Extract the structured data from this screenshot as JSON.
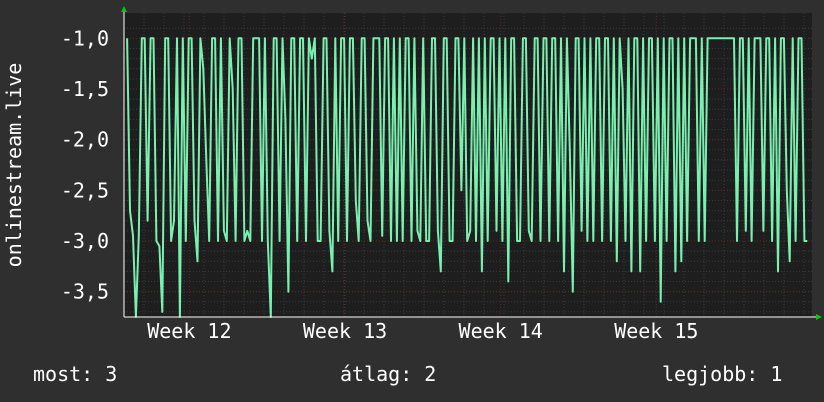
{
  "chart_data": {
    "type": "line",
    "ylabel": "onlinestream.live",
    "y_ticks": [
      "-1,0",
      "-1,5",
      "-2,0",
      "-2,5",
      "-3,0",
      "-3,5"
    ],
    "y_tick_values": [
      -1.0,
      -1.5,
      -2.0,
      -2.5,
      -3.0,
      -3.5
    ],
    "ylim": [
      -3.75,
      -0.75
    ],
    "x_ticks": [
      "Week 12",
      "Week 13",
      "Week 14",
      "Week 15"
    ],
    "x_tick_positions": [
      12,
      13,
      14,
      15
    ],
    "xlim": [
      11.58,
      16.0
    ],
    "grid": true,
    "colors": {
      "background": "#2f2f2f",
      "plot_bg": "#1e1e1e",
      "line": "#7af0b0",
      "grid": "#3a3a3a",
      "axis_arrow": "#00cc00"
    },
    "series": [
      {
        "values": [
          -1.0,
          -2.7,
          -2.95,
          -3.75,
          -2.95,
          -1.0,
          -1.0,
          -2.8,
          -1.0,
          -1.0,
          -3.0,
          -3.05,
          -3.7,
          -1.0,
          -1.0,
          -3.0,
          -2.8,
          -1.0,
          -3.75,
          -1.0,
          -3.0,
          -1.0,
          -1.0,
          -2.8,
          -3.2,
          -1.0,
          -1.3,
          -2.2,
          -3.0,
          -1.0,
          -1.0,
          -3.0,
          -1.0,
          -2.9,
          -3.0,
          -1.0,
          -1.5,
          -3.0,
          -1.0,
          -1.0,
          -3.0,
          -2.9,
          -3.0,
          -1.0,
          -1.0,
          -1.0,
          -3.0,
          -1.0,
          -3.0,
          -3.75,
          -1.0,
          -1.0,
          -3.0,
          -1.0,
          -1.8,
          -3.5,
          -1.0,
          -1.0,
          -3.0,
          -1.0,
          -1.0,
          -3.0,
          -1.0,
          -1.2,
          -1.0,
          -3.0,
          -3.0,
          -1.0,
          -1.0,
          -2.9,
          -3.3,
          -1.0,
          -3.0,
          -1.0,
          -1.0,
          -3.0,
          -1.0,
          -1.0,
          -2.6,
          -3.0,
          -1.0,
          -1.0,
          -2.8,
          -3.0,
          -1.0,
          -1.0,
          -1.0,
          -2.95,
          -1.0,
          -1.0,
          -3.0,
          -1.0,
          -3.0,
          -1.0,
          -3.0,
          -1.0,
          -1.0,
          -3.0,
          -1.0,
          -2.9,
          -3.0,
          -1.0,
          -3.0,
          -3.0,
          -1.0,
          -1.0,
          -2.9,
          -3.3,
          -1.0,
          -1.0,
          -3.0,
          -3.0,
          -1.0,
          -1.0,
          -2.5,
          -1.0,
          -3.0,
          -2.9,
          -1.0,
          -3.0,
          -1.0,
          -3.3,
          -1.0,
          -3.0,
          -1.0,
          -1.0,
          -2.9,
          -1.0,
          -3.0,
          -1.0,
          -3.4,
          -1.0,
          -1.0,
          -3.0,
          -3.0,
          -1.0,
          -1.0,
          -2.9,
          -3.0,
          -1.0,
          -1.0,
          -3.0,
          -1.0,
          -1.0,
          -3.0,
          -1.0,
          -1.0,
          -3.0,
          -1.0,
          -3.3,
          -1.0,
          -2.1,
          -3.5,
          -1.0,
          -1.0,
          -2.9,
          -1.0,
          -3.0,
          -1.0,
          -3.0,
          -1.0,
          -1.0,
          -3.0,
          -1.0,
          -1.0,
          -3.0,
          -1.0,
          -3.2,
          -1.0,
          -1.5,
          -3.0,
          -1.0,
          -3.3,
          -1.0,
          -1.0,
          -3.3,
          -1.0,
          -3.0,
          -1.0,
          -1.0,
          -3.0,
          -1.0,
          -3.6,
          -1.0,
          -3.0,
          -1.0,
          -1.0,
          -3.3,
          -1.0,
          -3.2,
          -1.0,
          -3.0,
          -1.0,
          -1.0,
          -1.0,
          -3.0,
          -1.0,
          -3.0,
          -1.0,
          -1.0,
          -1.0,
          -1.0,
          -1.0,
          -1.0,
          -1.0,
          -1.0,
          -1.0,
          -1.0,
          -3.0,
          -1.0,
          -1.0,
          -2.9,
          -1.0,
          -3.0,
          -1.0,
          -1.0,
          -1.0,
          -2.9,
          -1.0,
          -1.0,
          -3.0,
          -1.0,
          -3.3,
          -1.0,
          -1.0,
          -2.5,
          -3.2,
          -1.0,
          -3.0,
          -1.0,
          -1.0,
          -3.0,
          -3.0
        ],
        "x_start": 11.6,
        "x_end": 15.97
      }
    ]
  },
  "footer": {
    "current": "most: 3",
    "average": "átlag: 2",
    "best": "legjobb: 1"
  }
}
